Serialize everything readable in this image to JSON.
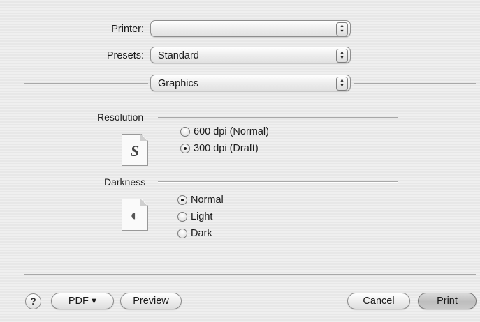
{
  "printer": {
    "label": "Printer:",
    "value": ""
  },
  "presets": {
    "label": "Presets:",
    "value": "Standard"
  },
  "panel": {
    "value": "Graphics"
  },
  "resolution": {
    "title": "Resolution",
    "options": [
      {
        "label": "600 dpi (Normal)",
        "selected": false
      },
      {
        "label": "300 dpi (Draft)",
        "selected": true
      }
    ]
  },
  "darkness": {
    "title": "Darkness",
    "options": [
      {
        "label": "Normal",
        "selected": true
      },
      {
        "label": "Light",
        "selected": false
      },
      {
        "label": "Dark",
        "selected": false
      }
    ]
  },
  "icons": {
    "resolution_glyph": "S",
    "darkness_glyph": "◐"
  },
  "footer": {
    "help": "?",
    "pdf": "PDF ▾",
    "preview": "Preview",
    "cancel": "Cancel",
    "print": "Print"
  }
}
